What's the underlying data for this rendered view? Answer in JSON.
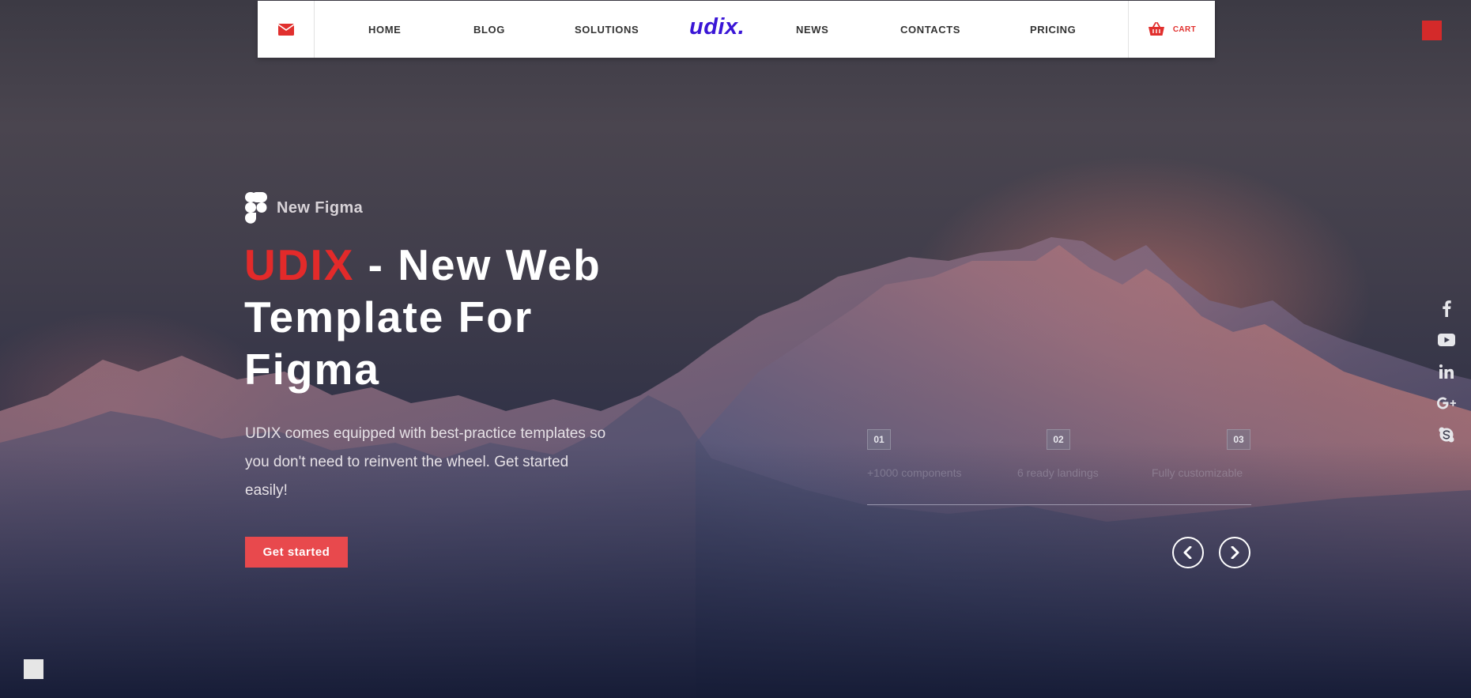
{
  "nav": {
    "mail_icon": "envelope-icon",
    "links": [
      {
        "label": "HOME"
      },
      {
        "label": "BLOG"
      },
      {
        "label": "SOLUTIONS"
      },
      {
        "label": "NEWS"
      },
      {
        "label": "CONTACTS"
      },
      {
        "label": "PRICING"
      }
    ],
    "logo": "udix.",
    "cart_label": "CART",
    "cart_icon": "basket-icon"
  },
  "hero": {
    "brand_label": "New Figma",
    "brand_icon": "figma-icon",
    "headline_accent": "UDIX",
    "headline_rest": " - New Web Template For Figma",
    "description": "UDIX comes equipped with best-practice templates so you don't need to reinvent the wheel. Get started easily!",
    "cta_label": "Get started"
  },
  "steps": [
    {
      "num": "01",
      "label": "+1000 components"
    },
    {
      "num": "02",
      "label": "6 ready landings"
    },
    {
      "num": "03",
      "label": "Fully customizable"
    }
  ],
  "social_icons": [
    "facebook-icon",
    "youtube-icon",
    "linkedin-icon",
    "google-plus-icon",
    "skype-icon"
  ],
  "colors": {
    "accent_red": "#e32a2a",
    "button_red": "#e8494d",
    "logo_blue": "#3a16d6",
    "nav_bg": "#ffffff"
  }
}
